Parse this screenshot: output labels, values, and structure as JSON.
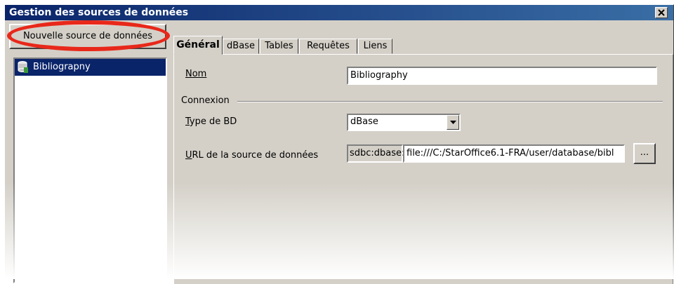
{
  "window": {
    "title": "Gestion des sources de données"
  },
  "left_panel": {
    "new_button_label": "Nouvelle source de données",
    "items": [
      {
        "label": "Bibliograpny",
        "icon": "database-icon"
      }
    ]
  },
  "tabs": [
    {
      "label": "Général",
      "active": true
    },
    {
      "label": "dBase",
      "active": false
    },
    {
      "label": "Tables",
      "active": false
    },
    {
      "label": "Requêtes",
      "active": false
    },
    {
      "label": "Liens",
      "active": false
    }
  ],
  "general": {
    "name_label": "Nom",
    "name_value": "Bibliography",
    "connection_heading": "Connexion",
    "db_type_label": "Type de BD",
    "db_type_value": "dBase",
    "url_label": "URL de la source de données",
    "url_prefix": "sdbc:dbase:",
    "url_value": "file:///C:/StarOffice6.1-FRA/user/database/bibl",
    "browse_button_label": "..."
  },
  "colors": {
    "title_bar": "#0a246a",
    "highlight_ellipse": "#e8281a",
    "selection": "#0a246a",
    "dialog_bg": "#d4d0c8"
  }
}
